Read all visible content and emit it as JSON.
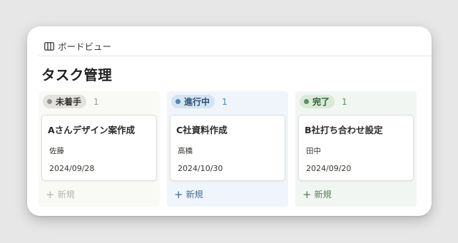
{
  "view": {
    "icon": "board-icon",
    "label": "ボードビュー"
  },
  "database": {
    "title": "タスク管理"
  },
  "columns": [
    {
      "status": "未着手",
      "count": "1",
      "colors": {
        "bg": "#f9f9f5",
        "pill": "#e3e2de",
        "dot": "#91918e",
        "text": "#37352f",
        "count": "#9b9a97",
        "new": "#b5b4b1"
      },
      "card": {
        "title": "Aさんデザイン案作成",
        "owner": "佐藤",
        "date": "2024/09/28"
      },
      "new_label": "新規"
    },
    {
      "status": "進行中",
      "count": "1",
      "colors": {
        "bg": "#eff5fa",
        "pill": "#d3e5f2",
        "dot": "#4d84b5",
        "text": "#2a4f73",
        "count": "#4d84b5",
        "new": "#3b6e99"
      },
      "card": {
        "title": "C社資料作成",
        "owner": "高橋",
        "date": "2024/10/30"
      },
      "new_label": "新規"
    },
    {
      "status": "完了",
      "count": "1",
      "colors": {
        "bg": "#f2f6f2",
        "pill": "#d9ead9",
        "dot": "#5c8f61",
        "text": "#2e5a33",
        "count": "#5c8f61",
        "new": "#4c7f52"
      },
      "card": {
        "title": "B社打ち合わせ設定",
        "owner": "田中",
        "date": "2024/09/20"
      },
      "new_label": "新規"
    }
  ]
}
